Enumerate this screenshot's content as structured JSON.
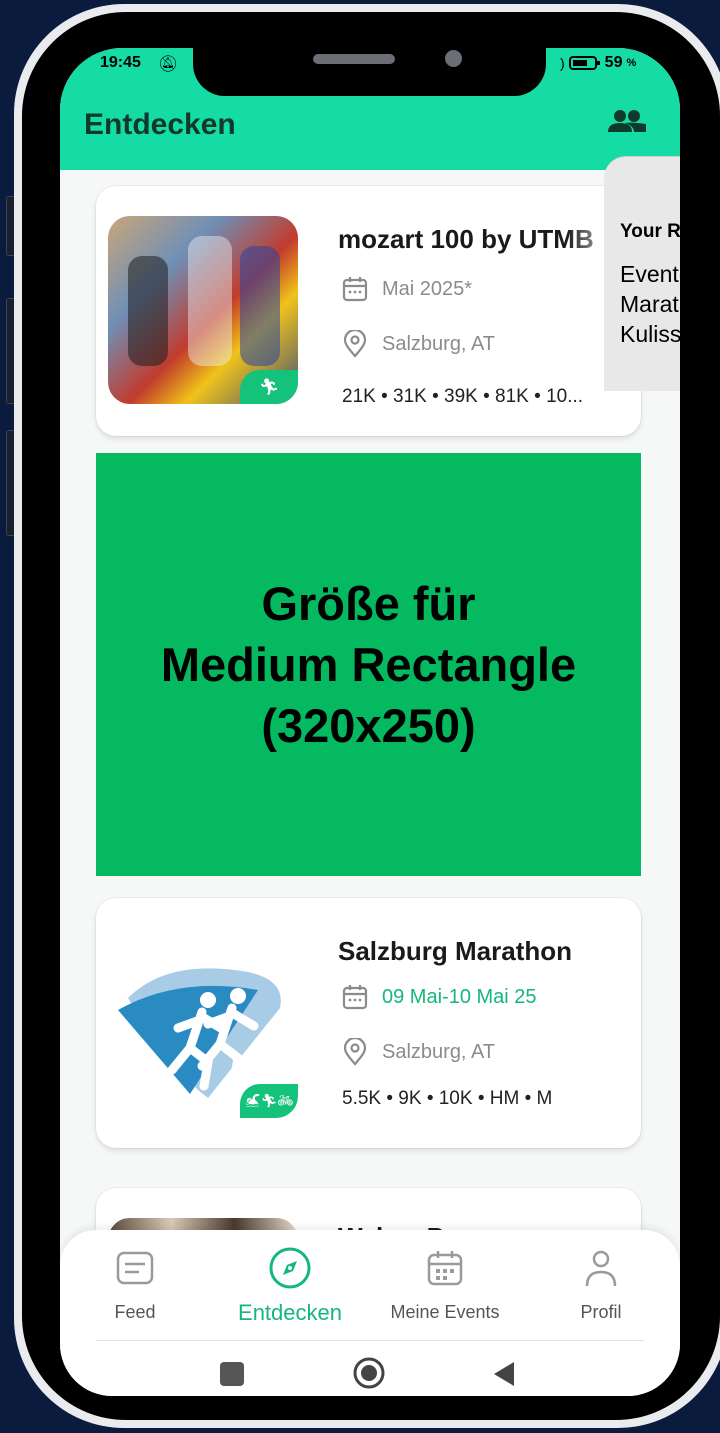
{
  "status_bar": {
    "time": "19:45",
    "battery": "59"
  },
  "header": {
    "title": "Entdecken"
  },
  "events": [
    {
      "name": "mozart 100 by UTMB",
      "date": "Mai 2025*",
      "location": "Salzburg, AT",
      "distances": "21K • 31K • 39K • 81K • 10..."
    },
    {
      "name": "Salzburg Marathon",
      "date": "09 Mai-10 Mai 25",
      "location": "Salzburg, AT",
      "distances": "5.5K • 9K • 10K • HM • M"
    },
    {
      "name": "Wals – Pr...",
      "date": "",
      "location": "",
      "distances": ""
    }
  ],
  "ad": {
    "line1": "Größe für",
    "line2": "Medium Rectangle",
    "line3": "(320x250)"
  },
  "tooltip": {
    "title": "Your Ru",
    "line1": "Event-T",
    "line2": "Marath",
    "line3": "Kulisse"
  },
  "bottom_nav": {
    "items": [
      {
        "label": "Feed",
        "icon": "feed-icon"
      },
      {
        "label": "Entdecken",
        "icon": "compass-icon",
        "active": true
      },
      {
        "label": "Meine Events",
        "icon": "calendar-icon"
      },
      {
        "label": "Profil",
        "icon": "profile-icon"
      }
    ]
  },
  "colors": {
    "accent": "#15dba5",
    "brand_green": "#15c27c",
    "ad_green": "#04b95f",
    "frame": "#0b1b3d"
  }
}
